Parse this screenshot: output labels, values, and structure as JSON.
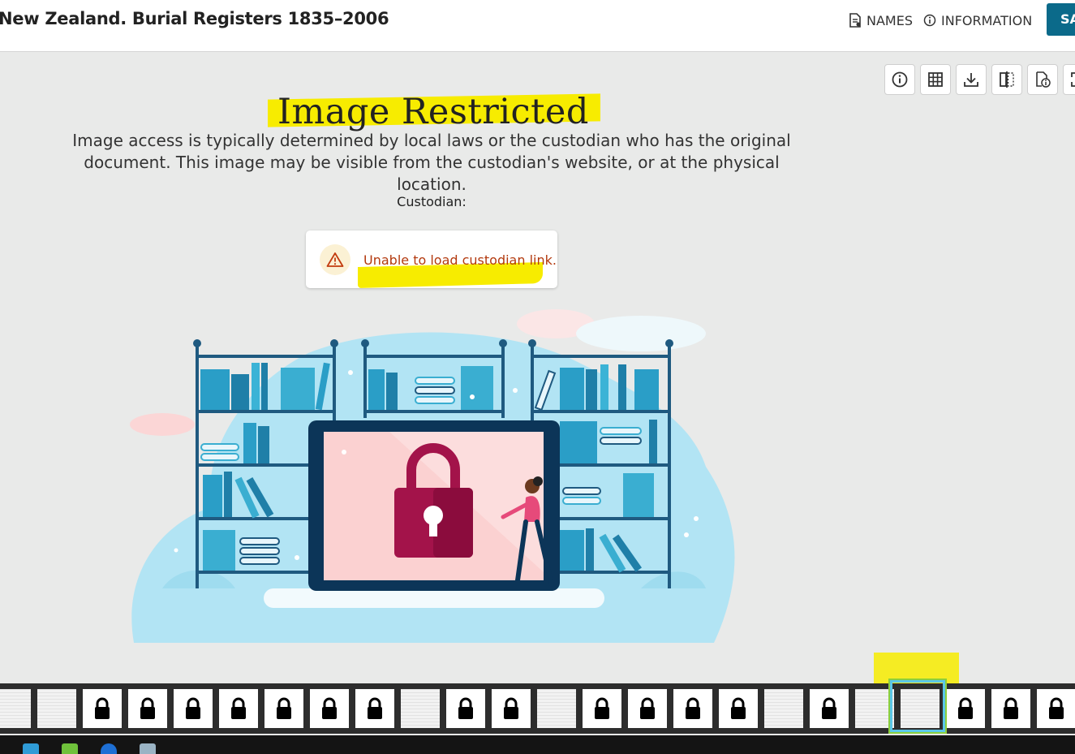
{
  "header": {
    "title": "New Zealand. Burial Registers 1835–2006",
    "nav_names": "NAMES",
    "nav_information": "INFORMATION",
    "save_label": "SA"
  },
  "toolbar": {
    "icons": [
      "info-icon",
      "grid-icon",
      "download-icon",
      "compare-icon",
      "document-info-icon",
      "fullscreen-icon"
    ]
  },
  "main": {
    "heading": "Image Restricted",
    "description": "Image access is typically determined by local laws or the custodian who has the original document. This image may be visible from the custodian's website, or at the physical location.",
    "custodian_label": "Custodian:",
    "alert_text": "Unable to load custodian link."
  },
  "filmstrip": {
    "thumbnails": [
      "doc",
      "doc",
      "lock",
      "lock",
      "lock",
      "lock",
      "lock",
      "lock",
      "lock",
      "doc",
      "lock",
      "lock",
      "doc",
      "lock",
      "lock",
      "lock",
      "lock",
      "doc",
      "lock",
      "doc",
      "doc",
      "lock",
      "lock",
      "lock"
    ],
    "selected_index": 20
  },
  "colors": {
    "accent": "#0b6a8a",
    "highlight": "#f7ec00",
    "warning_text": "#b33a0f",
    "lock_red": "#a3134a"
  }
}
